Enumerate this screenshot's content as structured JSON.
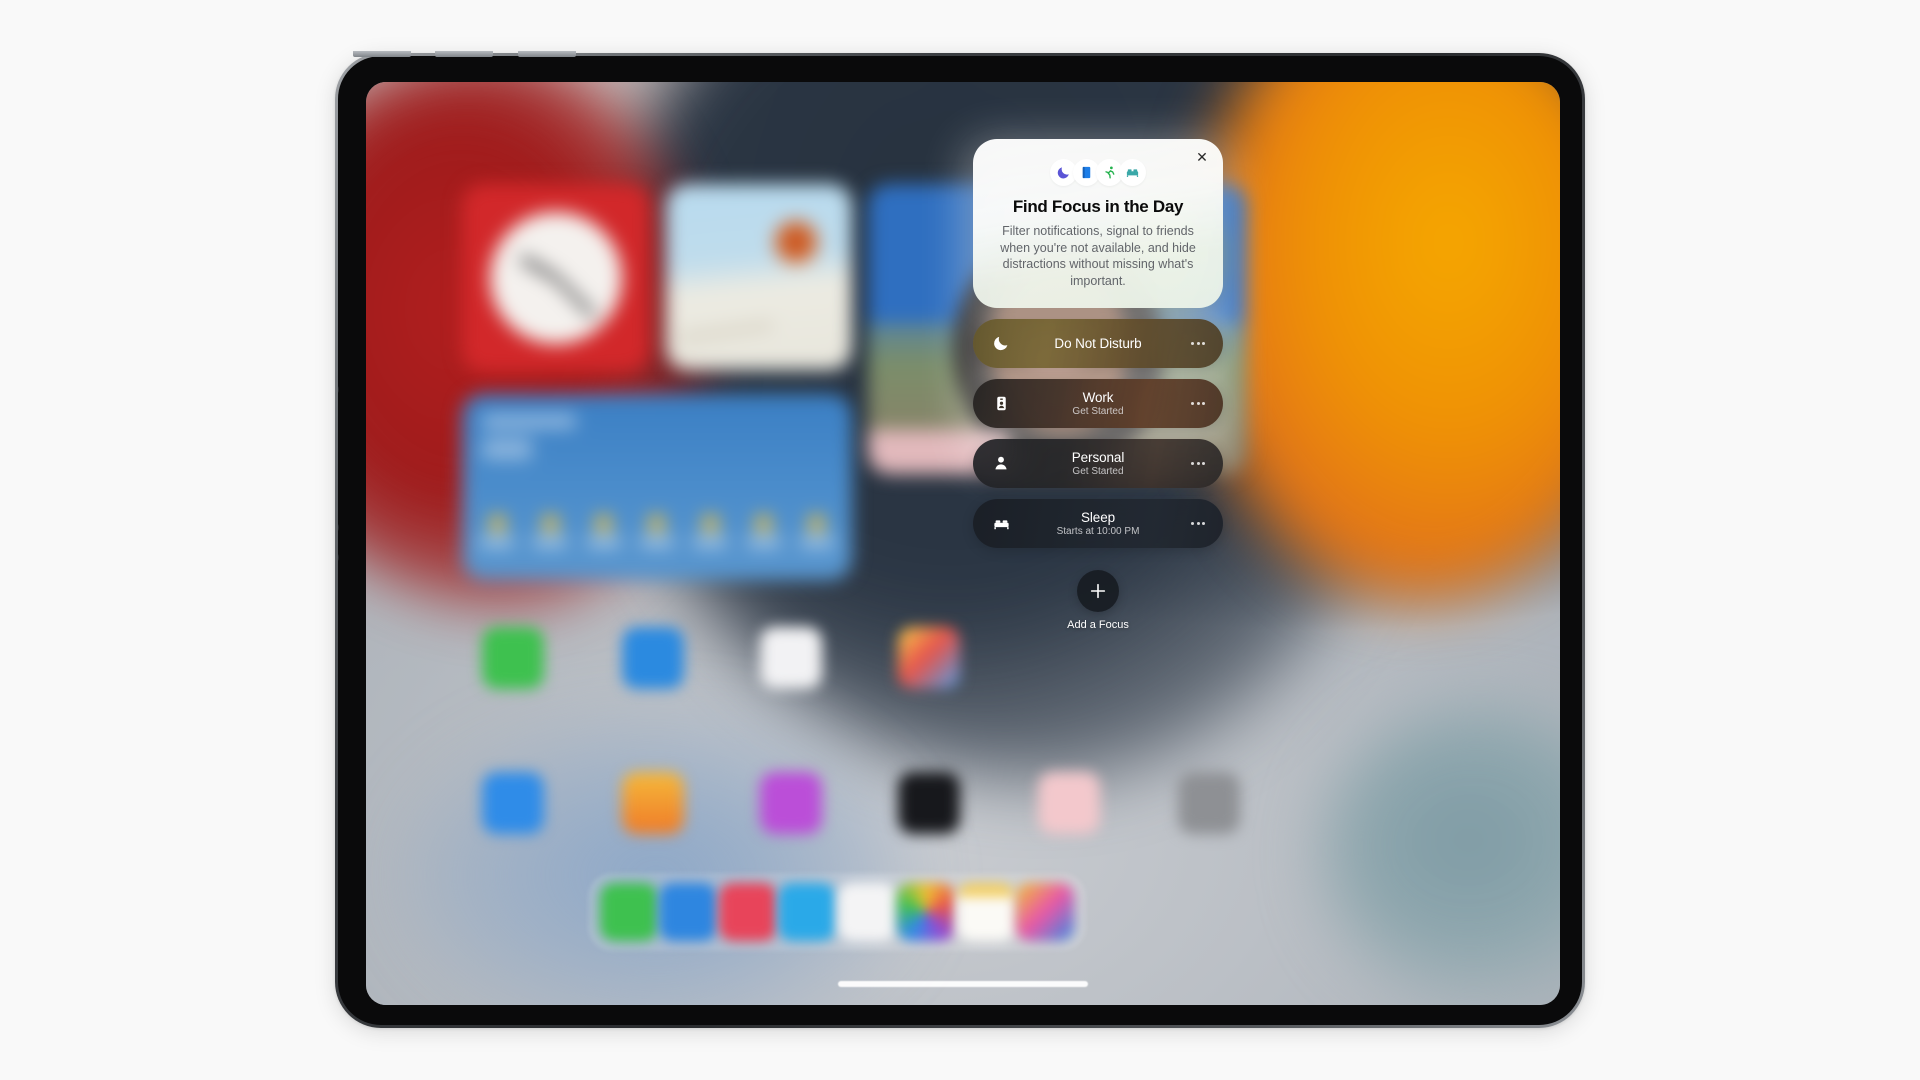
{
  "device": {
    "name": "iPad Pro",
    "orientation": "landscape"
  },
  "focus_panel": {
    "info_card": {
      "close_label": "✕",
      "title": "Find Focus in the Day",
      "description": "Filter notifications, signal to friends when you're not available, and hide distractions without missing what's important.",
      "icons": [
        {
          "name": "moon-icon",
          "glyph": "🌙",
          "color": "#5b55d6"
        },
        {
          "name": "book-icon",
          "glyph": "📘",
          "color": "#1d7ee8"
        },
        {
          "name": "running-person-icon",
          "glyph": "🏃",
          "color": "#22b14c"
        },
        {
          "name": "bed-icon",
          "glyph": "🛏",
          "color": "#3aa8a8"
        }
      ]
    },
    "modes": [
      {
        "id": "do-not-disturb",
        "icon": "moon-icon",
        "title": "Do Not Disturb",
        "subtitle": "",
        "more_label": "…",
        "tint": "#6b5a2c"
      },
      {
        "id": "work",
        "icon": "id-badge-icon",
        "title": "Work",
        "subtitle": "Get Started",
        "more_label": "…",
        "tint": "#5c3821"
      },
      {
        "id": "personal",
        "icon": "person-icon",
        "title": "Personal",
        "subtitle": "Get Started",
        "more_label": "…",
        "tint": "#2e2b2c"
      },
      {
        "id": "sleep",
        "icon": "bed-icon",
        "title": "Sleep",
        "subtitle": "Starts at 10:00 PM",
        "more_label": "…",
        "tint": "#222932"
      }
    ],
    "add_focus": {
      "label": "Add a Focus",
      "icon": "plus-icon"
    }
  },
  "home_screen": {
    "widgets": [
      {
        "name": "clock-widget",
        "app": "Clock",
        "color": "#d2282a"
      },
      {
        "name": "maps-widget",
        "app": "Maps",
        "color": "#bfdcec"
      },
      {
        "name": "weather-widget",
        "app": "Weather",
        "color": "#4a8ccb"
      },
      {
        "name": "photos-widget",
        "app": "Photos",
        "color": "#3d7cc6"
      }
    ],
    "app_icons_row1": [
      {
        "name": "messages-app-icon",
        "color": "#3ec14f"
      },
      {
        "name": "safari-app-icon",
        "color": "#2b8ae0"
      },
      {
        "name": "files-app-icon",
        "color": "#f2f2f4"
      },
      {
        "name": "photos-app-icon",
        "color": "#f0f0f2"
      }
    ],
    "app_icons_row2": [
      {
        "name": "app-store-app-icon",
        "color": "#2f8ce8"
      },
      {
        "name": "podcasts-app-icon",
        "color": "#f08a23"
      },
      {
        "name": "music-app-icon",
        "color": "#bb4ed8"
      },
      {
        "name": "tv-app-icon",
        "color": "#17181c"
      },
      {
        "name": "shortcuts-app-icon",
        "color": "#f3c8cc"
      },
      {
        "name": "settings-app-icon",
        "color": "#8e9094"
      }
    ],
    "dock_icons": [
      {
        "name": "messages-dock-icon",
        "color": "#3ec14f"
      },
      {
        "name": "safari-dock-icon",
        "color": "#2e86e0"
      },
      {
        "name": "music-dock-icon",
        "color": "#e8445a"
      },
      {
        "name": "facetime-dock-icon",
        "color": "#2aa9e8"
      },
      {
        "name": "books-dock-icon",
        "color": "#f4f4f5"
      },
      {
        "name": "photos-dock-icon",
        "color": "#efefef"
      },
      {
        "name": "notes-dock-icon",
        "color": "#f6f2e6"
      },
      {
        "name": "shortcuts-dock-icon",
        "color": "#f2eff2"
      }
    ],
    "home_indicator": "home-indicator-bar"
  }
}
